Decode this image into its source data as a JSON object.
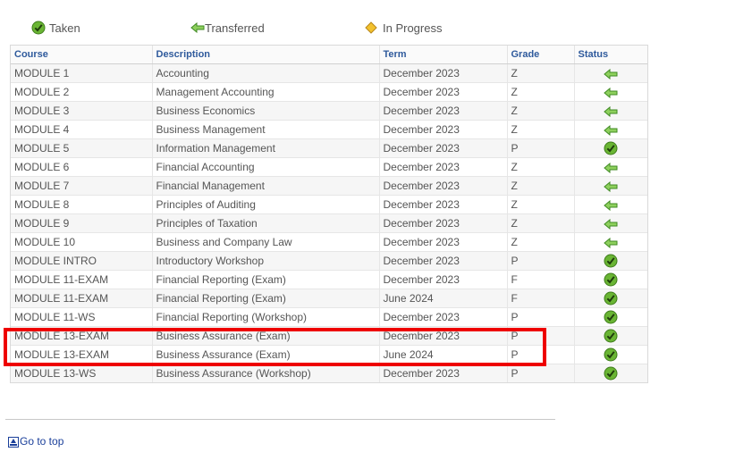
{
  "legend": {
    "taken": "Taken",
    "transferred": "Transferred",
    "in_progress": "In Progress"
  },
  "colors": {
    "header_text": "#2f5a9c",
    "taken_green": "#6ab534",
    "transferred_green": "#8ed05d",
    "in_progress_gold": "#f2c12e",
    "highlight_red": "#ee0000",
    "link": "#1a3f9a"
  },
  "table": {
    "headers": {
      "course": "Course",
      "description": "Description",
      "term": "Term",
      "grade": "Grade",
      "status": "Status"
    },
    "rows": [
      {
        "course": "MODULE 1",
        "description": "Accounting",
        "term": "December 2023",
        "grade": "Z",
        "status": "transferred"
      },
      {
        "course": "MODULE 2",
        "description": "Management Accounting",
        "term": "December 2023",
        "grade": "Z",
        "status": "transferred"
      },
      {
        "course": "MODULE 3",
        "description": "Business Economics",
        "term": "December 2023",
        "grade": "Z",
        "status": "transferred"
      },
      {
        "course": "MODULE 4",
        "description": "Business Management",
        "term": "December 2023",
        "grade": "Z",
        "status": "transferred"
      },
      {
        "course": "MODULE 5",
        "description": "Information Management",
        "term": "December 2023",
        "grade": "P",
        "status": "taken"
      },
      {
        "course": "MODULE 6",
        "description": "Financial Accounting",
        "term": "December 2023",
        "grade": "Z",
        "status": "transferred"
      },
      {
        "course": "MODULE 7",
        "description": "Financial Management",
        "term": "December 2023",
        "grade": "Z",
        "status": "transferred"
      },
      {
        "course": "MODULE 8",
        "description": "Principles of Auditing",
        "term": "December 2023",
        "grade": "Z",
        "status": "transferred"
      },
      {
        "course": "MODULE 9",
        "description": "Principles of Taxation",
        "term": "December 2023",
        "grade": "Z",
        "status": "transferred"
      },
      {
        "course": "MODULE 10",
        "description": "Business and Company Law",
        "term": "December 2023",
        "grade": "Z",
        "status": "transferred"
      },
      {
        "course": "MODULE INTRO",
        "description": "Introductory Workshop",
        "term": "December 2023",
        "grade": "P",
        "status": "taken"
      },
      {
        "course": "MODULE 11-EXAM",
        "description": "Financial Reporting (Exam)",
        "term": "December 2023",
        "grade": "F",
        "status": "taken"
      },
      {
        "course": "MODULE 11-EXAM",
        "description": "Financial Reporting (Exam)",
        "term": "June 2024",
        "grade": "F",
        "status": "taken"
      },
      {
        "course": "MODULE 11-WS",
        "description": "Financial Reporting (Workshop)",
        "term": "December 2023",
        "grade": "P",
        "status": "taken"
      },
      {
        "course": "MODULE 13-EXAM",
        "description": "Business Assurance (Exam)",
        "term": "December 2023",
        "grade": "P",
        "status": "taken"
      },
      {
        "course": "MODULE 13-EXAM",
        "description": "Business Assurance (Exam)",
        "term": "June 2024",
        "grade": "P",
        "status": "taken"
      },
      {
        "course": "MODULE 13-WS",
        "description": "Business Assurance (Workshop)",
        "term": "December 2023",
        "grade": "P",
        "status": "taken"
      }
    ]
  },
  "footer": {
    "go_to_top": "Go to top"
  }
}
